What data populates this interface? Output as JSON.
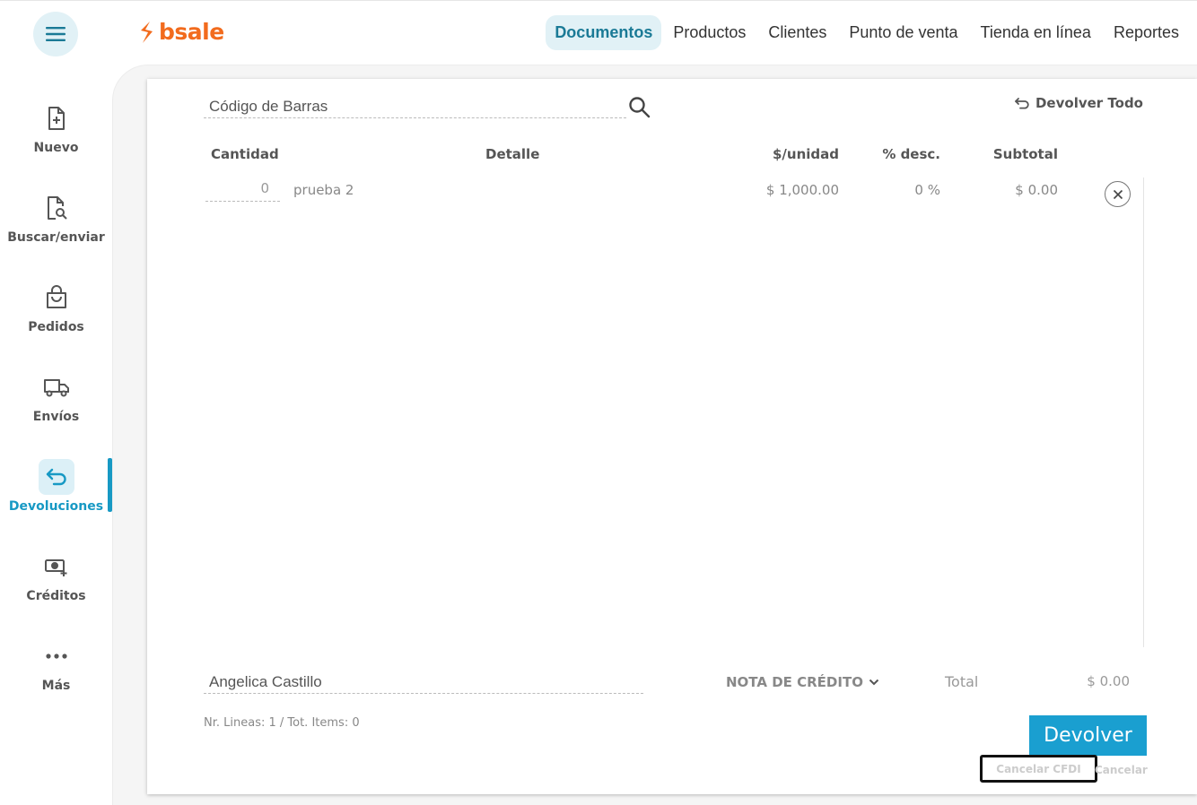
{
  "header": {
    "brand": "bsale",
    "nav": [
      {
        "label": "Documentos",
        "active": true
      },
      {
        "label": "Productos"
      },
      {
        "label": "Clientes"
      },
      {
        "label": "Punto de venta"
      },
      {
        "label": "Tienda en línea"
      },
      {
        "label": "Reportes"
      }
    ]
  },
  "sidebar": {
    "items": [
      {
        "label": "Nuevo",
        "icon": "file-plus-icon"
      },
      {
        "label": "Buscar/enviar",
        "icon": "file-search-icon"
      },
      {
        "label": "Pedidos",
        "icon": "shopping-bag-icon"
      },
      {
        "label": "Envíos",
        "icon": "truck-icon"
      },
      {
        "label": "Devoluciones",
        "icon": "return-arrow-icon",
        "active": true
      },
      {
        "label": "Créditos",
        "icon": "money-plus-icon"
      },
      {
        "label": "Más",
        "icon": "more-dots-icon"
      }
    ]
  },
  "form": {
    "barcode_placeholder": "Código de Barras",
    "return_all": "Devolver Todo",
    "columns": [
      "Cantidad",
      "Detalle",
      "$/unidad",
      "% desc.",
      "Subtotal"
    ],
    "rows": [
      {
        "cantidad": "0",
        "detalle": "prueba 2",
        "unit_price": "$ 1,000.00",
        "discount": "0 %",
        "subtotal": "$ 0.00"
      }
    ],
    "client": "Angelica Castillo",
    "document_type": "NOTA DE CRÉDITO",
    "total_label": "Total",
    "total_value": "$ 0.00",
    "summary": "Nr. Lineas: 1 / Tot. Items: 0",
    "return_button": "Devolver",
    "cancel_cfdi": "Cancelar CFDI",
    "cancel": "Cancelar"
  },
  "colors": {
    "accent": "#1799c4",
    "brand": "#f26b1d",
    "button": "#1a9fd0"
  }
}
